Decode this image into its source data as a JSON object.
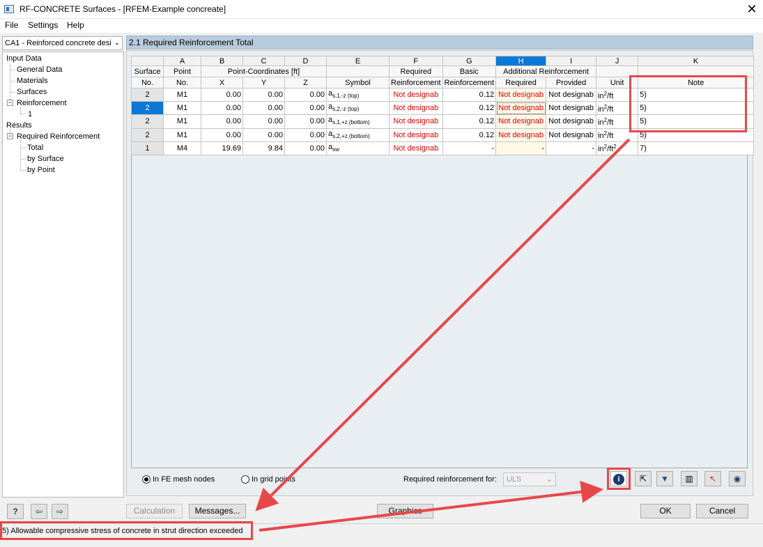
{
  "window": {
    "title": "RF-CONCRETE Surfaces - [RFEM-Example concreate]"
  },
  "menu": {
    "file": "File",
    "settings": "Settings",
    "help": "Help"
  },
  "case_select": {
    "value": "CA1 - Reinforced concrete desi"
  },
  "nav": {
    "input_data": "Input Data",
    "general_data": "General Data",
    "materials": "Materials",
    "surfaces": "Surfaces",
    "reinforcement": "Reinforcement",
    "reinforcement_1": "1",
    "results": "Results",
    "required_reinforcement": "Required Reinforcement",
    "total": "Total",
    "by_surface": "by Surface",
    "by_point": "by Point"
  },
  "panel": {
    "title": "2.1 Required Reinforcement Total"
  },
  "table": {
    "col_letters": [
      "A",
      "B",
      "C",
      "D",
      "E",
      "F",
      "G",
      "H",
      "I",
      "J",
      "K"
    ],
    "headers": {
      "surface": "Surface",
      "surface_no": "No.",
      "point": "Point",
      "point_no": "No.",
      "coords": "Point-Coordinates [ft]",
      "x": "X",
      "y": "Y",
      "z": "Z",
      "symbol": "Symbol",
      "required": "Required",
      "required_reinf": "Reinforcement",
      "basic": "Basic",
      "basic_reinf": "Reinforcement",
      "additional": "Additional Reinforcement",
      "add_required": "Required",
      "add_provided": "Provided",
      "unit": "Unit",
      "note": "Note"
    },
    "rows": [
      {
        "surface": "2",
        "point": "M1",
        "x": "0.00",
        "y": "0.00",
        "z": "0.00",
        "sym": "a",
        "sym_sub": "s,1,-z (top)",
        "req": "Not designab",
        "basic": "0.12",
        "add_req": "Not designab",
        "add_prov": "Not designab",
        "unit": "in",
        "unit_sup": "2",
        "unit_tail": "/ft",
        "unit_sup2": "",
        "note": "5)"
      },
      {
        "surface": "2",
        "point": "M1",
        "x": "0.00",
        "y": "0.00",
        "z": "0.00",
        "sym": "a",
        "sym_sub": "s,2,-z (top)",
        "req": "Not designab",
        "basic": "0.12",
        "add_req": "Not designab",
        "add_prov": "Not designab",
        "unit": "in",
        "unit_sup": "2",
        "unit_tail": "/ft",
        "unit_sup2": "",
        "note": "5)"
      },
      {
        "surface": "2",
        "point": "M1",
        "x": "0.00",
        "y": "0.00",
        "z": "0.00",
        "sym": "a",
        "sym_sub": "s,1,+z (bottom)",
        "req": "Not designab",
        "basic": "0.12",
        "add_req": "Not designab",
        "add_prov": "Not designab",
        "unit": "in",
        "unit_sup": "2",
        "unit_tail": "/ft",
        "unit_sup2": "",
        "note": "5)"
      },
      {
        "surface": "2",
        "point": "M1",
        "x": "0.00",
        "y": "0.00",
        "z": "0.00",
        "sym": "a",
        "sym_sub": "s,2,+z (bottom)",
        "req": "Not designab",
        "basic": "0.12",
        "add_req": "Not designab",
        "add_prov": "Not designab",
        "unit": "in",
        "unit_sup": "2",
        "unit_tail": "/ft",
        "unit_sup2": "",
        "note": "5)"
      },
      {
        "surface": "1",
        "point": "M4",
        "x": "19.69",
        "y": "9.84",
        "z": "0.00",
        "sym": "a",
        "sym_sub": "sw",
        "req": "Not designab",
        "basic": "-",
        "add_req": "-",
        "add_prov": "-",
        "unit": "in",
        "unit_sup": "2",
        "unit_tail": "/ft",
        "unit_sup2": "2",
        "note": "7)"
      }
    ]
  },
  "options": {
    "fe_mesh": "In FE mesh nodes",
    "grid_points": "In grid points",
    "req_for_label": "Required reinforcement for:",
    "req_for_value": "ULS"
  },
  "buttons": {
    "calculation": "Calculation",
    "messages": "Messages...",
    "graphics": "Graphics",
    "ok": "OK",
    "cancel": "Cancel"
  },
  "status": {
    "message": "5) Allowable compressive stress of concrete in strut direction exceeded"
  },
  "colors": {
    "annotation": "#e8474a",
    "selection": "#0a78d7",
    "error_text": "#e00000"
  }
}
